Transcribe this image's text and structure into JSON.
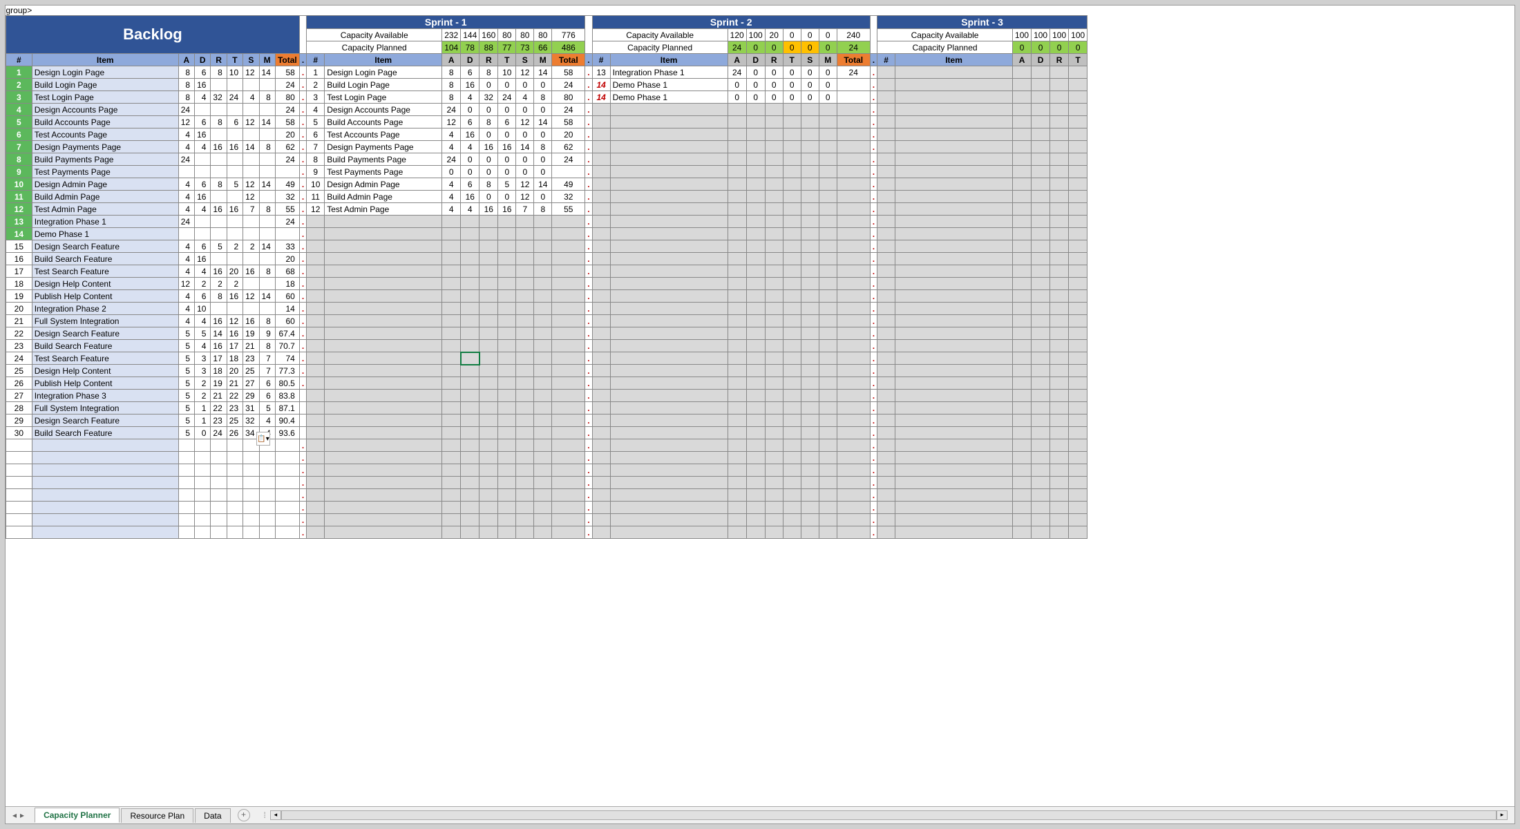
{
  "title": "Backlog",
  "sprints": [
    {
      "name": "Sprint - 1",
      "avail": [
        232,
        144,
        160,
        80,
        80,
        80,
        776
      ],
      "plan": [
        104,
        78,
        88,
        77,
        73,
        66,
        486
      ]
    },
    {
      "name": "Sprint - 2",
      "avail": [
        120,
        100,
        20,
        0,
        0,
        0,
        240
      ],
      "plan": [
        24,
        0,
        0,
        0,
        0,
        0,
        24
      ]
    },
    {
      "name": "Sprint - 3",
      "avail": [
        100,
        100,
        100,
        100
      ],
      "plan": [
        0,
        0,
        0,
        0
      ]
    }
  ],
  "capAvail": "Capacity Available",
  "capPlan": "Capacity Planned",
  "cols": [
    "A",
    "D",
    "R",
    "T",
    "S",
    "M"
  ],
  "hdr": {
    "num": "#",
    "item": "Item",
    "total": "Total"
  },
  "backlog": [
    {
      "n": 1,
      "g": 1,
      "item": "Design Login Page",
      "v": [
        8,
        6,
        8,
        10,
        12,
        14
      ],
      "t": 58
    },
    {
      "n": 2,
      "g": 1,
      "item": "Build Login Page",
      "v": [
        8,
        16,
        "",
        "",
        "",
        ""
      ],
      "t": 24
    },
    {
      "n": 3,
      "g": 1,
      "item": "Test Login Page",
      "v": [
        8,
        4,
        32,
        24,
        4,
        8
      ],
      "t": 80
    },
    {
      "n": 4,
      "g": 1,
      "item": "Design Accounts Page",
      "v": [
        24,
        "",
        "",
        "",
        "",
        ""
      ],
      "t": 24
    },
    {
      "n": 5,
      "g": 1,
      "item": "Build Accounts Page",
      "v": [
        12,
        6,
        8,
        6,
        12,
        14
      ],
      "t": 58
    },
    {
      "n": 6,
      "g": 1,
      "item": "Test Accounts Page",
      "v": [
        4,
        16,
        "",
        "",
        "",
        ""
      ],
      "t": 20
    },
    {
      "n": 7,
      "g": 1,
      "item": "Design Payments Page",
      "v": [
        4,
        4,
        16,
        16,
        14,
        8
      ],
      "t": 62
    },
    {
      "n": 8,
      "g": 1,
      "item": "Build Payments Page",
      "v": [
        24,
        "",
        "",
        "",
        "",
        ""
      ],
      "t": 24
    },
    {
      "n": 9,
      "g": 1,
      "item": "Test Payments Page",
      "v": [
        "",
        "",
        "",
        "",
        "",
        ""
      ],
      "t": ""
    },
    {
      "n": 10,
      "g": 1,
      "item": "Design Admin Page",
      "v": [
        4,
        6,
        8,
        5,
        12,
        14
      ],
      "t": 49
    },
    {
      "n": 11,
      "g": 1,
      "item": "Build Admin Page",
      "v": [
        4,
        16,
        "",
        "",
        12,
        ""
      ],
      "t": 32
    },
    {
      "n": 12,
      "g": 1,
      "item": "Test Admin Page",
      "v": [
        4,
        4,
        16,
        16,
        7,
        8
      ],
      "t": 55
    },
    {
      "n": 13,
      "g": 1,
      "item": "Integration Phase 1",
      "v": [
        24,
        "",
        "",
        "",
        "",
        ""
      ],
      "t": 24
    },
    {
      "n": 14,
      "g": 1,
      "item": "Demo Phase 1",
      "v": [
        "",
        "",
        "",
        "",
        "",
        ""
      ],
      "t": ""
    },
    {
      "n": 15,
      "g": 0,
      "item": "Design Search Feature",
      "v": [
        4,
        6,
        5,
        2,
        2,
        14
      ],
      "t": 33
    },
    {
      "n": 16,
      "g": 0,
      "item": "Build Search Feature",
      "v": [
        4,
        16,
        "",
        "",
        "",
        ""
      ],
      "t": 20
    },
    {
      "n": 17,
      "g": 0,
      "item": "Test Search Feature",
      "v": [
        4,
        4,
        16,
        20,
        16,
        8
      ],
      "t": 68
    },
    {
      "n": 18,
      "g": 0,
      "item": "Design Help Content",
      "v": [
        12,
        2,
        2,
        2,
        "",
        ""
      ],
      "t": 18
    },
    {
      "n": 19,
      "g": 0,
      "item": "Publish Help Content",
      "v": [
        4,
        6,
        8,
        16,
        12,
        14
      ],
      "t": 60
    },
    {
      "n": 20,
      "g": 0,
      "item": "Integration Phase 2",
      "v": [
        4,
        10,
        "",
        "",
        "",
        ""
      ],
      "t": 14
    },
    {
      "n": 21,
      "g": 0,
      "item": "Full System Integration",
      "v": [
        4,
        4,
        16,
        12,
        16,
        8
      ],
      "t": 60
    },
    {
      "n": 22,
      "g": 0,
      "item": "Design Search Feature",
      "v": [
        5,
        5,
        14,
        16,
        19,
        9
      ],
      "t": 67.4
    },
    {
      "n": 23,
      "g": 0,
      "item": "Build Search Feature",
      "v": [
        5,
        4,
        16,
        17,
        21,
        8
      ],
      "t": 70.7
    },
    {
      "n": 24,
      "g": 0,
      "item": "Test Search Feature",
      "v": [
        5,
        3,
        17,
        18,
        23,
        7
      ],
      "t": 74
    },
    {
      "n": 25,
      "g": 0,
      "item": "Design Help Content",
      "v": [
        5,
        3,
        18,
        20,
        25,
        7
      ],
      "t": 77.3
    },
    {
      "n": 26,
      "g": 0,
      "item": "Publish Help Content",
      "v": [
        5,
        2,
        19,
        21,
        27,
        6
      ],
      "t": 80.5
    },
    {
      "n": 27,
      "g": 0,
      "item": "Integration Phase 3",
      "v": [
        5,
        2,
        21,
        22,
        29,
        6
      ],
      "t": 83.8
    },
    {
      "n": 28,
      "g": 0,
      "item": "Full System Integration",
      "v": [
        5,
        1,
        22,
        23,
        31,
        5
      ],
      "t": 87.1
    },
    {
      "n": 29,
      "g": 0,
      "item": "Design Search Feature",
      "v": [
        5,
        1,
        23,
        25,
        32,
        4
      ],
      "t": 90.4
    },
    {
      "n": 30,
      "g": 0,
      "item": "Build Search Feature",
      "v": [
        5,
        0,
        24,
        26,
        34,
        4
      ],
      "t": 93.6
    }
  ],
  "sprint1Rows": [
    {
      "n": 1,
      "item": "Design Login Page",
      "v": [
        8,
        6,
        8,
        10,
        12,
        14
      ],
      "t": 58
    },
    {
      "n": 2,
      "item": "Build Login Page",
      "v": [
        8,
        16,
        0,
        0,
        0,
        0
      ],
      "t": 24
    },
    {
      "n": 3,
      "item": "Test Login Page",
      "v": [
        8,
        4,
        32,
        24,
        4,
        8
      ],
      "t": 80
    },
    {
      "n": 4,
      "item": "Design Accounts Page",
      "v": [
        24,
        0,
        0,
        0,
        0,
        0
      ],
      "t": 24
    },
    {
      "n": 5,
      "item": "Build Accounts Page",
      "v": [
        12,
        6,
        8,
        6,
        12,
        14
      ],
      "t": 58
    },
    {
      "n": 6,
      "item": "Test Accounts Page",
      "v": [
        4,
        16,
        0,
        0,
        0,
        0
      ],
      "t": 20
    },
    {
      "n": 7,
      "item": "Design Payments Page",
      "v": [
        4,
        4,
        16,
        16,
        14,
        8
      ],
      "t": 62
    },
    {
      "n": 8,
      "item": "Build Payments Page",
      "v": [
        24,
        0,
        0,
        0,
        0,
        0
      ],
      "t": 24
    },
    {
      "n": 9,
      "item": "Test Payments Page",
      "v": [
        0,
        0,
        0,
        0,
        0,
        0
      ],
      "t": ""
    },
    {
      "n": 10,
      "item": "Design Admin Page",
      "v": [
        4,
        6,
        8,
        5,
        12,
        14
      ],
      "t": 49
    },
    {
      "n": 11,
      "item": "Build Admin Page",
      "v": [
        4,
        16,
        0,
        0,
        12,
        0
      ],
      "t": 32
    },
    {
      "n": 12,
      "item": "Test Admin Page",
      "v": [
        4,
        4,
        16,
        16,
        7,
        8
      ],
      "t": 55
    }
  ],
  "sprint2Rows": [
    {
      "n": 13,
      "item": "Integration Phase 1",
      "v": [
        24,
        0,
        0,
        0,
        0,
        0
      ],
      "t": 24
    },
    {
      "n": 14,
      "red": 1,
      "item": "Demo Phase 1",
      "v": [
        0,
        0,
        0,
        0,
        0,
        0
      ],
      "t": ""
    },
    {
      "n": 14,
      "red": 1,
      "item": "Demo Phase 1",
      "v": [
        0,
        0,
        0,
        0,
        0,
        0
      ],
      "t": ""
    }
  ],
  "tabs": [
    {
      "name": "Capacity Planner",
      "active": true
    },
    {
      "name": "Resource Plan",
      "active": false
    },
    {
      "name": "Data",
      "active": false
    }
  ]
}
